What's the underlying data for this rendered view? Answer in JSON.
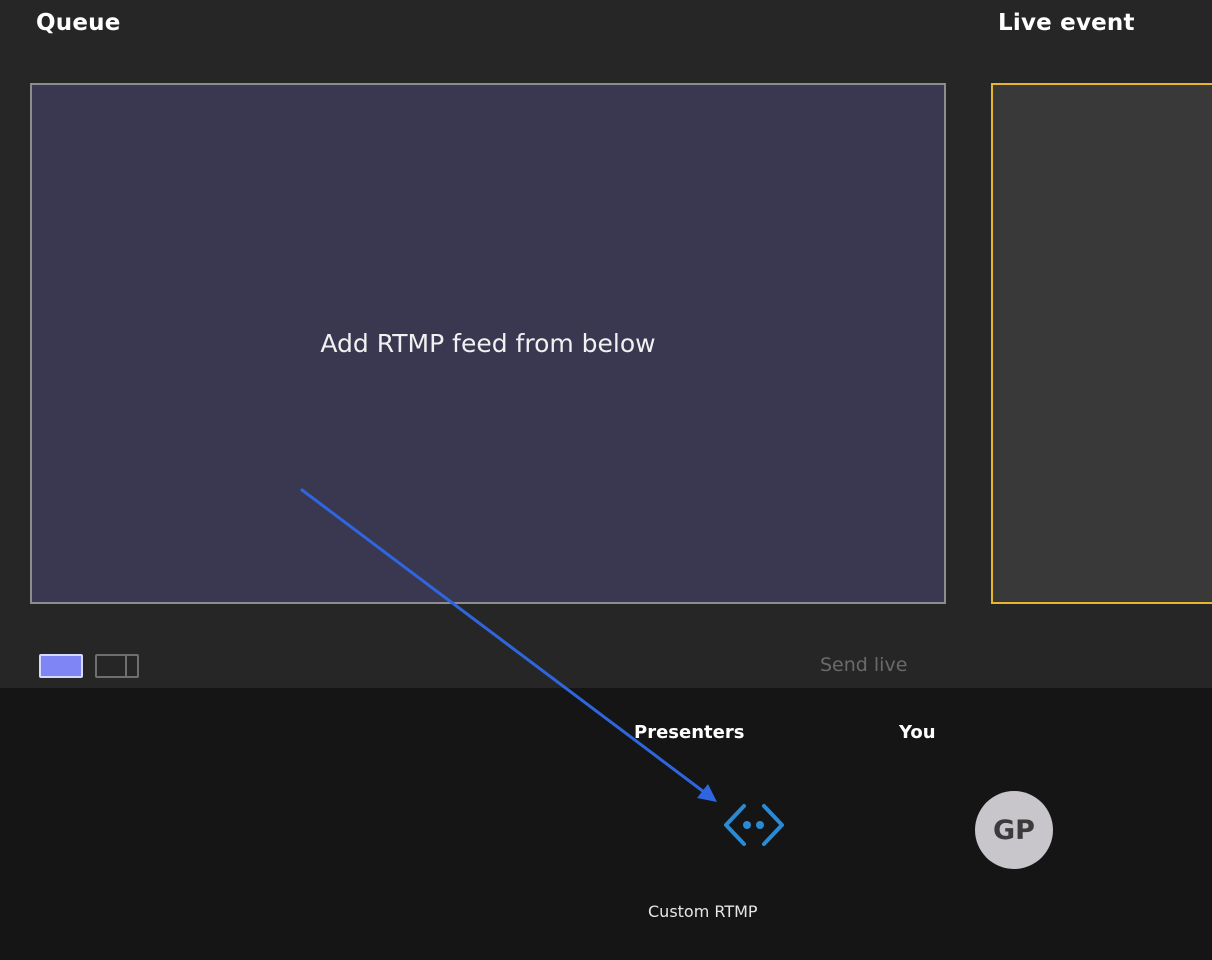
{
  "queue": {
    "title": "Queue",
    "message": "Add RTMP feed from below"
  },
  "live_event": {
    "title": "Live event"
  },
  "controls": {
    "send_live_label": "Send live",
    "layout_options": [
      "single-layout-icon",
      "split-layout-icon"
    ]
  },
  "bottom": {
    "presenters_title": "Presenters",
    "you_title": "You",
    "rtmp_source_label": "Custom RTMP",
    "rtmp_icon": "custom-rtmp-icon",
    "avatar_initials": "GP"
  },
  "colors": {
    "accent": "#7f85f5",
    "live_border": "#e8b62c",
    "rtmp_icon": "#2a8ad4",
    "annotation_arrow": "#2f66e0"
  }
}
